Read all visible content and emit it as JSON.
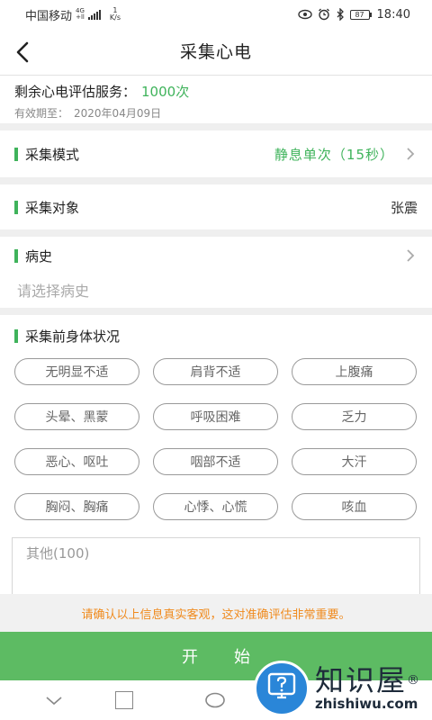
{
  "status_bar": {
    "carrier": "中国移动",
    "net_type_top": "4G",
    "net_type_bottom": "+ll",
    "speed_value": "1",
    "speed_unit": "K/s",
    "battery": "87",
    "time": "18:40"
  },
  "header": {
    "title": "采集心电"
  },
  "service": {
    "label": "剩余心电评估服务：",
    "count": "1000次",
    "expire_label": "有效期至：",
    "expire_date": "2020年04月09日"
  },
  "rows": {
    "mode_label": "采集模式",
    "mode_value": "静息单次（15秒）",
    "subject_label": "采集对象",
    "subject_value": "张震",
    "history_label": "病史",
    "history_placeholder": "请选择病史",
    "condition_label": "采集前身体状况"
  },
  "tags": [
    "无明显不适",
    "肩背不适",
    "上腹痛",
    "头晕、黑蒙",
    "呼吸困难",
    "乏力",
    "恶心、呕吐",
    "咽部不适",
    "大汗",
    "胸闷、胸痛",
    "心悸、心慌",
    "咳血"
  ],
  "other": {
    "placeholder": "其他(100)"
  },
  "notice": "请确认以上信息真实客观，这对准确评估非常重要。",
  "start_button": "开始",
  "watermark": {
    "cn": "知识屋",
    "en": "zhishiwu.com",
    "mark": "®"
  },
  "colors": {
    "accent": "#3fb35b",
    "button": "#5dbb63",
    "notice": "#f08a1d"
  }
}
